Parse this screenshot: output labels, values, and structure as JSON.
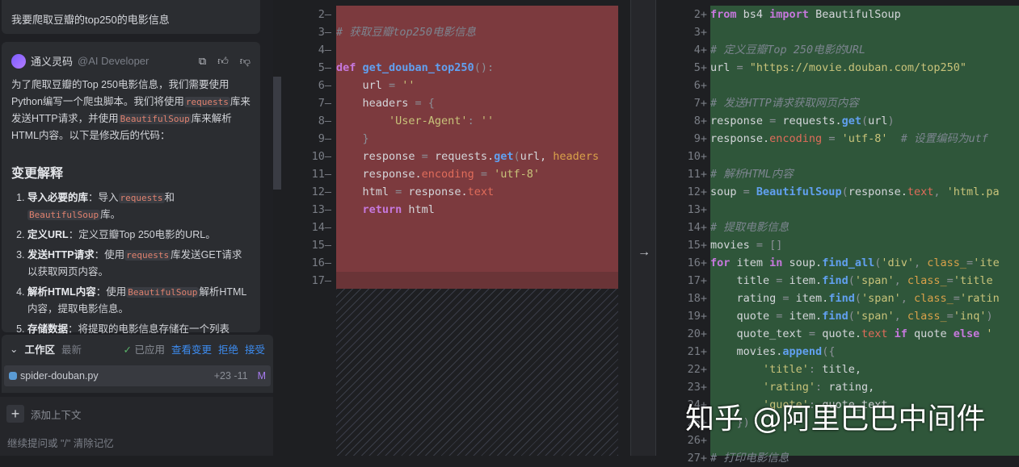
{
  "chat": {
    "user_message": "我要爬取豆瓣的top250的电影信息",
    "ai_name": "通义灵码",
    "ai_handle": "@AI Developer",
    "intro": [
      "为了爬取豆瓣的Top 250电影信息，我们需要使用Python编写一个爬虫脚本。我们将使用",
      "requests",
      "库来发送HTTP请求，并使用",
      "BeautifulSoup",
      "库来解析HTML内容。以下是修改后的代码："
    ],
    "section_title": "变更解释",
    "items": [
      {
        "b": "导入必要的库",
        "t": "：导入",
        "c1": "requests",
        "t2": "和",
        "c2": "BeautifulSoup",
        "t3": "库。"
      },
      {
        "b": "定义URL",
        "t": "：定义豆瓣Top 250电影的URL。"
      },
      {
        "b": "发送HTTP请求",
        "t": "：使用",
        "c1": "requests",
        "t2": "库发送GET请求以获取网页内容。"
      },
      {
        "b": "解析HTML内容",
        "t": "：使用",
        "c1": "BeautifulSoup",
        "t2": "解析HTML内容，提取电影信息。"
      },
      {
        "b": "存储数据",
        "t": "：将提取的电影信息存储在一个列表"
      }
    ]
  },
  "workspace": {
    "title": "工作区",
    "filter": "最新",
    "status": "已应用",
    "view_changes": "查看变更",
    "reject": "拒绝",
    "accept": "接受",
    "file": {
      "name": "spider-douban.py",
      "diff": "+23 -11",
      "badge": "M"
    }
  },
  "input": {
    "add_context": "添加上下文",
    "placeholder": "继续提问或 \"/\" 清除记忆"
  },
  "left_code": [
    {
      "n": "2—",
      "t": []
    },
    {
      "n": "3—",
      "t": [
        [
          "cm",
          "# 获取豆瓣top250电影信息"
        ]
      ]
    },
    {
      "n": "4—",
      "t": []
    },
    {
      "n": "5—",
      "t": [
        [
          "kw",
          "def "
        ],
        [
          "fn",
          "get_douban_top250"
        ],
        [
          "op",
          "():"
        ]
      ]
    },
    {
      "n": "6—",
      "t": [
        [
          "pl",
          "    url "
        ],
        [
          "op",
          "= "
        ],
        [
          "str",
          "''"
        ]
      ]
    },
    {
      "n": "7—",
      "t": [
        [
          "pl",
          "    headers "
        ],
        [
          "op",
          "= {"
        ]
      ]
    },
    {
      "n": "8—",
      "t": [
        [
          "str",
          "        'User-Agent'"
        ],
        [
          "op",
          ": "
        ],
        [
          "str",
          "''"
        ]
      ]
    },
    {
      "n": "9—",
      "t": [
        [
          "op",
          "    }"
        ]
      ]
    },
    {
      "n": "10—",
      "t": [
        [
          "pl",
          "    response "
        ],
        [
          "op",
          "= "
        ],
        [
          "pl",
          "requests."
        ],
        [
          "fn",
          "get"
        ],
        [
          "op",
          "("
        ],
        [
          "pl",
          "url, "
        ],
        [
          "kw2",
          "headers"
        ]
      ]
    },
    {
      "n": "11—",
      "t": [
        [
          "pl",
          "    response."
        ],
        [
          "attr",
          "encoding"
        ],
        [
          "op",
          " = "
        ],
        [
          "str",
          "'utf-8'"
        ]
      ]
    },
    {
      "n": "12—",
      "t": [
        [
          "pl",
          "    html "
        ],
        [
          "op",
          "= "
        ],
        [
          "pl",
          "response."
        ],
        [
          "attr",
          "text"
        ]
      ]
    },
    {
      "n": "13—",
      "t": [
        [
          "kw",
          "    return "
        ],
        [
          "pl",
          "html"
        ]
      ]
    },
    {
      "n": "14—",
      "t": []
    },
    {
      "n": "15—",
      "t": []
    },
    {
      "n": "16—",
      "t": []
    },
    {
      "n": "17—",
      "t": []
    }
  ],
  "right_code": [
    {
      "n": "2+",
      "t": [
        [
          "kw",
          "from "
        ],
        [
          "pl",
          "bs4 "
        ],
        [
          "kw",
          "import "
        ],
        [
          "pl",
          "BeautifulSoup"
        ]
      ]
    },
    {
      "n": "3+",
      "t": []
    },
    {
      "n": "4+",
      "t": [
        [
          "cm",
          "# 定义豆瓣Top 250电影的URL"
        ]
      ]
    },
    {
      "n": "5+",
      "t": [
        [
          "pl",
          "url "
        ],
        [
          "op",
          "= "
        ],
        [
          "str",
          "\"https://movie.douban.com/top250\""
        ]
      ]
    },
    {
      "n": "6+",
      "t": []
    },
    {
      "n": "7+",
      "t": [
        [
          "cm",
          "# 发送HTTP请求获取网页内容"
        ]
      ]
    },
    {
      "n": "8+",
      "t": [
        [
          "pl",
          "response "
        ],
        [
          "op",
          "= "
        ],
        [
          "pl",
          "requests."
        ],
        [
          "fn",
          "get"
        ],
        [
          "op",
          "("
        ],
        [
          "pl",
          "url"
        ],
        [
          "op",
          ")"
        ]
      ]
    },
    {
      "n": "9+",
      "t": [
        [
          "pl",
          "response."
        ],
        [
          "attr",
          "encoding"
        ],
        [
          "op",
          " = "
        ],
        [
          "str",
          "'utf-8'"
        ],
        [
          "cm",
          "  # 设置编码为utf"
        ]
      ]
    },
    {
      "n": "10+",
      "t": []
    },
    {
      "n": "11+",
      "t": [
        [
          "cm",
          "# 解析HTML内容"
        ]
      ]
    },
    {
      "n": "12+",
      "t": [
        [
          "pl",
          "soup "
        ],
        [
          "op",
          "= "
        ],
        [
          "fn",
          "BeautifulSoup"
        ],
        [
          "op",
          "("
        ],
        [
          "pl",
          "response."
        ],
        [
          "attr",
          "text"
        ],
        [
          "op",
          ", "
        ],
        [
          "str",
          "'html.pa"
        ]
      ]
    },
    {
      "n": "13+",
      "t": []
    },
    {
      "n": "14+",
      "t": [
        [
          "cm",
          "# 提取电影信息"
        ]
      ]
    },
    {
      "n": "15+",
      "t": [
        [
          "pl",
          "movies "
        ],
        [
          "op",
          "= []"
        ]
      ]
    },
    {
      "n": "16+",
      "t": [
        [
          "kw",
          "for "
        ],
        [
          "pl",
          "item "
        ],
        [
          "kw",
          "in "
        ],
        [
          "pl",
          "soup."
        ],
        [
          "fn",
          "find_all"
        ],
        [
          "op",
          "("
        ],
        [
          "str",
          "'div'"
        ],
        [
          "op",
          ", "
        ],
        [
          "kw2",
          "class_"
        ],
        [
          "op",
          "="
        ],
        [
          "str",
          "'ite"
        ]
      ]
    },
    {
      "n": "17+",
      "t": [
        [
          "pl",
          "    title "
        ],
        [
          "op",
          "= "
        ],
        [
          "pl",
          "item."
        ],
        [
          "fn",
          "find"
        ],
        [
          "op",
          "("
        ],
        [
          "str",
          "'span'"
        ],
        [
          "op",
          ", "
        ],
        [
          "kw2",
          "class_"
        ],
        [
          "op",
          "="
        ],
        [
          "str",
          "'title"
        ]
      ]
    },
    {
      "n": "18+",
      "t": [
        [
          "pl",
          "    rating "
        ],
        [
          "op",
          "= "
        ],
        [
          "pl",
          "item."
        ],
        [
          "fn",
          "find"
        ],
        [
          "op",
          "("
        ],
        [
          "str",
          "'span'"
        ],
        [
          "op",
          ", "
        ],
        [
          "kw2",
          "class_"
        ],
        [
          "op",
          "="
        ],
        [
          "str",
          "'ratin"
        ]
      ]
    },
    {
      "n": "19+",
      "t": [
        [
          "pl",
          "    quote "
        ],
        [
          "op",
          "= "
        ],
        [
          "pl",
          "item."
        ],
        [
          "fn",
          "find"
        ],
        [
          "op",
          "("
        ],
        [
          "str",
          "'span'"
        ],
        [
          "op",
          ", "
        ],
        [
          "kw2",
          "class_"
        ],
        [
          "op",
          "="
        ],
        [
          "str",
          "'inq'"
        ],
        [
          "op",
          ")"
        ]
      ]
    },
    {
      "n": "20+",
      "t": [
        [
          "pl",
          "    quote_text "
        ],
        [
          "op",
          "= "
        ],
        [
          "pl",
          "quote."
        ],
        [
          "attr",
          "text "
        ],
        [
          "kw",
          "if "
        ],
        [
          "pl",
          "quote "
        ],
        [
          "kw",
          "else "
        ],
        [
          "str",
          "'"
        ]
      ]
    },
    {
      "n": "21+",
      "t": [
        [
          "pl",
          "    movies."
        ],
        [
          "fn",
          "append"
        ],
        [
          "op",
          "({"
        ]
      ]
    },
    {
      "n": "22+",
      "t": [
        [
          "str",
          "        'title'"
        ],
        [
          "op",
          ": "
        ],
        [
          "pl",
          "title,"
        ]
      ]
    },
    {
      "n": "23+",
      "t": [
        [
          "str",
          "        'rating'"
        ],
        [
          "op",
          ": "
        ],
        [
          "pl",
          "rating,"
        ]
      ]
    },
    {
      "n": "24+",
      "t": [
        [
          "str",
          "        'quote'"
        ],
        [
          "op",
          ": "
        ],
        [
          "pl",
          "quote_text"
        ]
      ]
    },
    {
      "n": "25+",
      "t": [
        [
          "op",
          "    })"
        ]
      ]
    },
    {
      "n": "26+",
      "t": []
    },
    {
      "n": "27+",
      "t": [
        [
          "cm",
          "# 打印电影信息"
        ]
      ]
    }
  ],
  "watermark": "知乎 @阿里巴巴中间件"
}
